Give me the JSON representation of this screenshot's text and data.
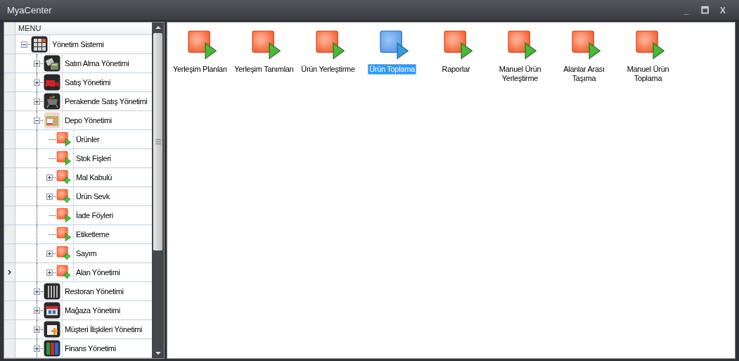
{
  "window": {
    "title": "MyaCenter",
    "controls": [
      "_",
      "🗖",
      "X"
    ]
  },
  "menu": {
    "header": "MENU",
    "items": [
      {
        "label": "Yönetim Sistemi",
        "kind": "module",
        "expanded": true,
        "focused": false,
        "children": [
          {
            "label": "Satın Alma Yönetimi",
            "kind": "module",
            "expanded": false,
            "focused": false
          },
          {
            "label": "Satış Yönetimi",
            "kind": "module",
            "expanded": false,
            "focused": false
          },
          {
            "label": "Perakende Satış Yönetimi",
            "kind": "module",
            "expanded": false,
            "focused": false
          },
          {
            "label": "Depo Yönetimi",
            "kind": "module",
            "expanded": true,
            "focused": false,
            "children": [
              {
                "label": "Ürünler",
                "kind": "form",
                "focused": false
              },
              {
                "label": "Stok Fişleri",
                "kind": "form",
                "focused": false
              },
              {
                "label": "Mal Kabulü",
                "kind": "group",
                "expanded": false,
                "focused": false
              },
              {
                "label": "Ürün Sevk",
                "kind": "group",
                "expanded": false,
                "focused": false
              },
              {
                "label": "İade Föyleri",
                "kind": "form",
                "focused": false
              },
              {
                "label": "Etiketleme",
                "kind": "form",
                "focused": false
              },
              {
                "label": "Sayım",
                "kind": "group",
                "expanded": false,
                "focused": false
              },
              {
                "label": "Alan Yönetimi",
                "kind": "group",
                "expanded": false,
                "focused": true
              }
            ]
          },
          {
            "label": "Restoran Yönetimi",
            "kind": "module",
            "expanded": false,
            "focused": false
          },
          {
            "label": "Mağaza Yönetimi",
            "kind": "module",
            "expanded": false,
            "focused": false
          },
          {
            "label": "Müşteri İlişkileri Yönetimi",
            "kind": "module",
            "expanded": false,
            "focused": false
          },
          {
            "label": "Finans Yönetimi",
            "kind": "module",
            "expanded": false,
            "focused": false
          }
        ]
      }
    ]
  },
  "forms": [
    {
      "label": "Yerleşim Planları",
      "selected": false
    },
    {
      "label": "Yerleşim Tanımları",
      "selected": false
    },
    {
      "label": "Ürün Yerleştirme",
      "selected": false
    },
    {
      "label": "Ürün Toplama",
      "selected": true
    },
    {
      "label": "Raporlar",
      "selected": false
    },
    {
      "label": "Manuel Ürün Yerleştirme",
      "selected": false
    },
    {
      "label": "Alanlar Arası Taşıma",
      "selected": false
    },
    {
      "label": "Manuel Ürün Toplama",
      "selected": false
    }
  ]
}
